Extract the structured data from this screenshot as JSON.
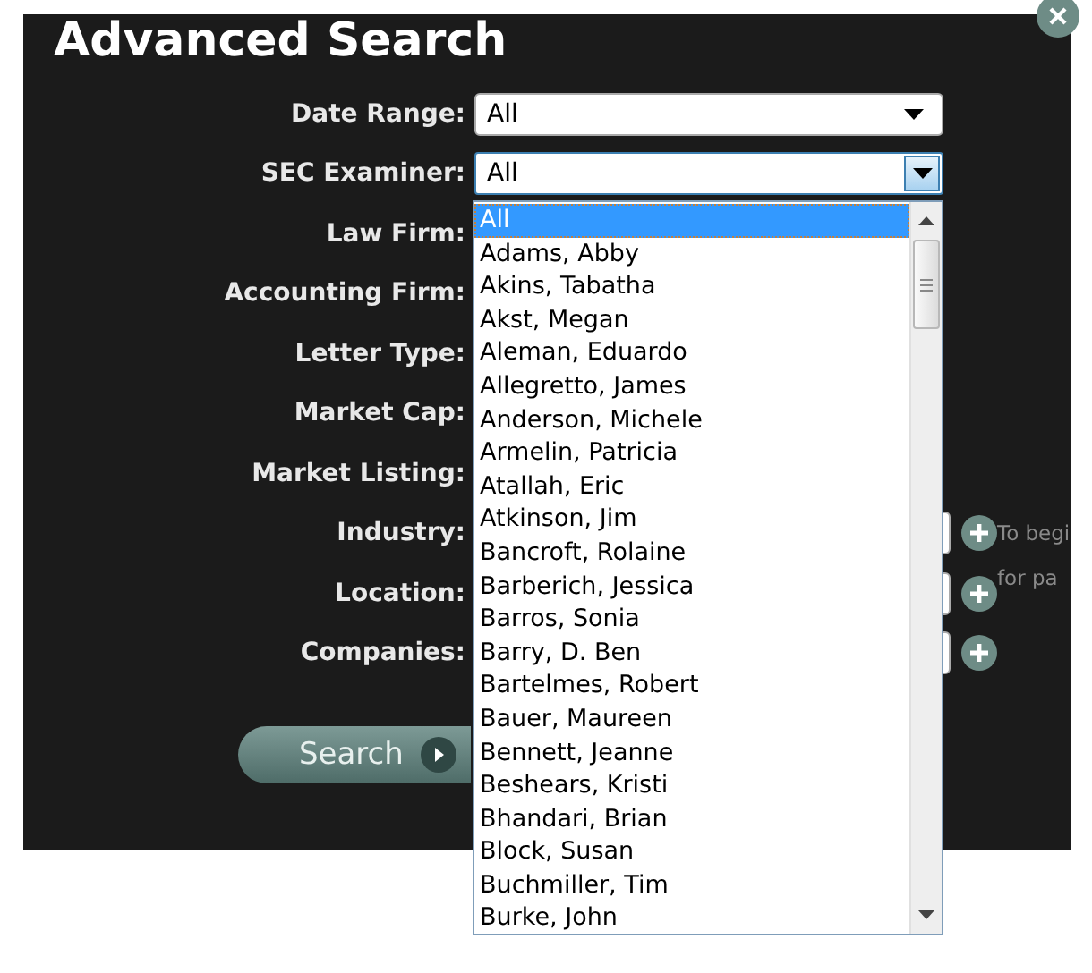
{
  "dialog": {
    "title": "Advanced Search"
  },
  "fields": [
    {
      "label": "Date Range:",
      "kind": "select",
      "value": "All",
      "open": false
    },
    {
      "label": "SEC Examiner:",
      "kind": "select",
      "value": "All",
      "open": true
    },
    {
      "label": "Law Firm:",
      "kind": "covered"
    },
    {
      "label": "Accounting Firm:",
      "kind": "covered"
    },
    {
      "label": "Letter Type:",
      "kind": "covered"
    },
    {
      "label": "Market Cap:",
      "kind": "covered"
    },
    {
      "label": "Market Listing:",
      "kind": "covered"
    },
    {
      "label": "Industry:",
      "kind": "add"
    },
    {
      "label": "Location:",
      "kind": "add"
    },
    {
      "label": "Companies:",
      "kind": "add"
    }
  ],
  "hint_lines": [
    "To begi",
    "for pa"
  ],
  "search_button": {
    "label": "Search"
  },
  "options": [
    {
      "label": "All",
      "selected": true
    },
    {
      "label": "Adams, Abby",
      "selected": false
    },
    {
      "label": "Akins, Tabatha",
      "selected": false
    },
    {
      "label": "Akst, Megan",
      "selected": false
    },
    {
      "label": "Aleman, Eduardo",
      "selected": false
    },
    {
      "label": "Allegretto, James",
      "selected": false
    },
    {
      "label": "Anderson, Michele",
      "selected": false
    },
    {
      "label": "Armelin, Patricia",
      "selected": false
    },
    {
      "label": "Atallah, Eric",
      "selected": false
    },
    {
      "label": "Atkinson, Jim",
      "selected": false
    },
    {
      "label": "Bancroft, Rolaine",
      "selected": false
    },
    {
      "label": "Barberich, Jessica",
      "selected": false
    },
    {
      "label": "Barros, Sonia",
      "selected": false
    },
    {
      "label": "Barry, D. Ben",
      "selected": false
    },
    {
      "label": "Bartelmes, Robert",
      "selected": false
    },
    {
      "label": "Bauer, Maureen",
      "selected": false
    },
    {
      "label": "Bennett, Jeanne",
      "selected": false
    },
    {
      "label": "Beshears, Kristi",
      "selected": false
    },
    {
      "label": "Bhandari, Brian",
      "selected": false
    },
    {
      "label": "Block, Susan",
      "selected": false
    },
    {
      "label": "Buchmiller, Tim",
      "selected": false
    },
    {
      "label": "Burke, John",
      "selected": false
    }
  ]
}
